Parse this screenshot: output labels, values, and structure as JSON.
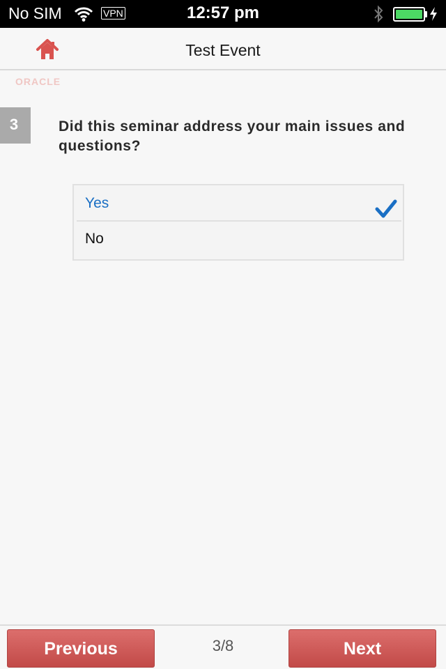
{
  "status_bar": {
    "carrier": "No SIM",
    "vpn": "VPN",
    "time": "12:57 pm",
    "battery_level": 1.0,
    "icons": [
      "wifi-icon",
      "bluetooth-icon",
      "battery-icon",
      "charging-icon"
    ]
  },
  "header": {
    "title": "Test Event",
    "home_icon": "home-icon",
    "logo": "ORACLE"
  },
  "question": {
    "number": "3",
    "text": "Did this seminar address your main issues and questions?",
    "options": [
      {
        "label": "Yes",
        "selected": true
      },
      {
        "label": "No",
        "selected": false
      }
    ]
  },
  "footer": {
    "previous_label": "Previous",
    "page_indicator": "3/8",
    "next_label": "Next"
  },
  "colors": {
    "accent_red": "#d05b59",
    "selected_blue": "#1a6fc4",
    "battery_green": "#4cd964"
  }
}
